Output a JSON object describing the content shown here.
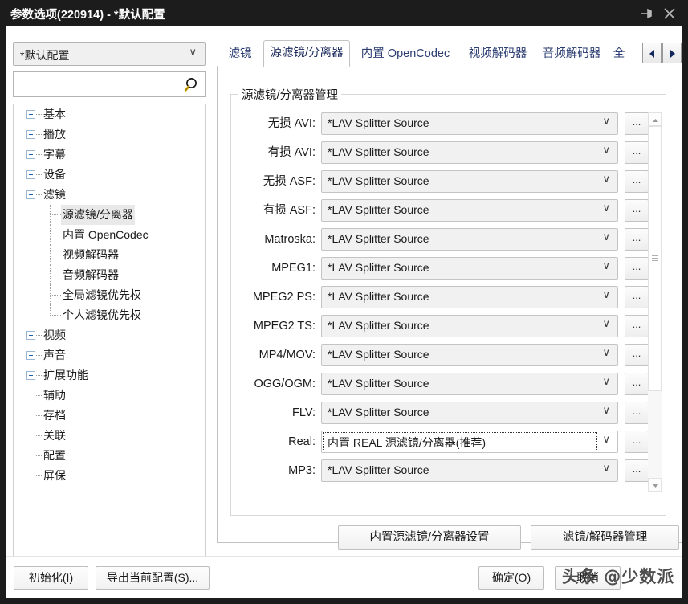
{
  "window": {
    "title": "参数选项(220914) - *默认配置",
    "pin_icon": "pin-icon",
    "close_icon": "close-icon"
  },
  "sidebar": {
    "profile": {
      "value": "*默认配置",
      "arrow": "∨"
    },
    "search": {
      "value": "",
      "placeholder": "",
      "icon": "search-icon"
    },
    "tree": [
      {
        "label": "基本",
        "level": 0,
        "expander": "plus"
      },
      {
        "label": "播放",
        "level": 0,
        "expander": "plus"
      },
      {
        "label": "字幕",
        "level": 0,
        "expander": "plus"
      },
      {
        "label": "设备",
        "level": 0,
        "expander": "plus"
      },
      {
        "label": "滤镜",
        "level": 0,
        "expander": "minus"
      },
      {
        "label": "源滤镜/分离器",
        "level": 1,
        "selected": true
      },
      {
        "label": "内置 OpenCodec",
        "level": 1
      },
      {
        "label": "视频解码器",
        "level": 1
      },
      {
        "label": "音频解码器",
        "level": 1
      },
      {
        "label": "全局滤镜优先权",
        "level": 1
      },
      {
        "label": "个人滤镜优先权",
        "level": 1,
        "last": true
      },
      {
        "label": "视频",
        "level": 0,
        "expander": "plus"
      },
      {
        "label": "声音",
        "level": 0,
        "expander": "plus"
      },
      {
        "label": "扩展功能",
        "level": 0,
        "expander": "plus"
      },
      {
        "label": "辅助",
        "level": 0
      },
      {
        "label": "存档",
        "level": 0
      },
      {
        "label": "关联",
        "level": 0
      },
      {
        "label": "配置",
        "level": 0
      },
      {
        "label": "屏保",
        "level": 0,
        "last": true
      }
    ]
  },
  "tabs": {
    "items": [
      {
        "label": "滤镜",
        "active": false
      },
      {
        "label": "源滤镜/分离器",
        "active": true
      },
      {
        "label": "内置 OpenCodec",
        "active": false
      },
      {
        "label": "视频解码器",
        "active": false
      },
      {
        "label": "音频解码器",
        "active": false
      },
      {
        "label": "全",
        "active": false
      }
    ],
    "prev_icon": "triangle-left-icon",
    "next_icon": "triangle-right-icon"
  },
  "group": {
    "title": "源滤镜/分离器管理",
    "rows": [
      {
        "label": "无损 AVI:",
        "value": "*LAV Splitter Source",
        "arrow": "∨",
        "dots": "...",
        "focused": false
      },
      {
        "label": "有损 AVI:",
        "value": "*LAV Splitter Source",
        "arrow": "∨",
        "dots": "...",
        "focused": false
      },
      {
        "label": "无损 ASF:",
        "value": "*LAV Splitter Source",
        "arrow": "∨",
        "dots": "...",
        "focused": false
      },
      {
        "label": "有损 ASF:",
        "value": "*LAV Splitter Source",
        "arrow": "∨",
        "dots": "...",
        "focused": false
      },
      {
        "label": "Matroska:",
        "value": "*LAV Splitter Source",
        "arrow": "∨",
        "dots": "...",
        "focused": false
      },
      {
        "label": "MPEG1:",
        "value": "*LAV Splitter Source",
        "arrow": "∨",
        "dots": "...",
        "focused": false
      },
      {
        "label": "MPEG2 PS:",
        "value": "*LAV Splitter Source",
        "arrow": "∨",
        "dots": "...",
        "focused": false
      },
      {
        "label": "MPEG2 TS:",
        "value": "*LAV Splitter Source",
        "arrow": "∨",
        "dots": "...",
        "focused": false
      },
      {
        "label": "MP4/MOV:",
        "value": "*LAV Splitter Source",
        "arrow": "∨",
        "dots": "...",
        "focused": false
      },
      {
        "label": "OGG/OGM:",
        "value": "*LAV Splitter Source",
        "arrow": "∨",
        "dots": "...",
        "focused": false
      },
      {
        "label": "FLV:",
        "value": "*LAV Splitter Source",
        "arrow": "∨",
        "dots": "...",
        "focused": false
      },
      {
        "label": "Real:",
        "value": "内置 REAL 源滤镜/分离器(推荐)",
        "arrow": "∨",
        "dots": "...",
        "focused": true
      },
      {
        "label": "MP3:",
        "value": "*LAV Splitter Source",
        "arrow": "∨",
        "dots": "...",
        "focused": false
      }
    ],
    "scrollbar": {
      "up_icon": "scroll-up-icon",
      "down_icon": "scroll-down-icon"
    },
    "buttons": {
      "builtin_source": "内置源滤镜/分离器设置",
      "filter_manager": "滤镜/解码器管理"
    }
  },
  "footer": {
    "init": "初始化(I)",
    "export": "导出当前配置(S)...",
    "ok": "确定(O)",
    "cancel": "取消"
  },
  "watermark": {
    "text": "头条 @少数派"
  },
  "colors": {
    "titlebar_bg": "#1c1c1c",
    "titlebar_fg": "#ffffff",
    "tab_fg": "#2a3c72",
    "combo_bg": "#f1f1f1",
    "accent": "#1a5fb4"
  }
}
